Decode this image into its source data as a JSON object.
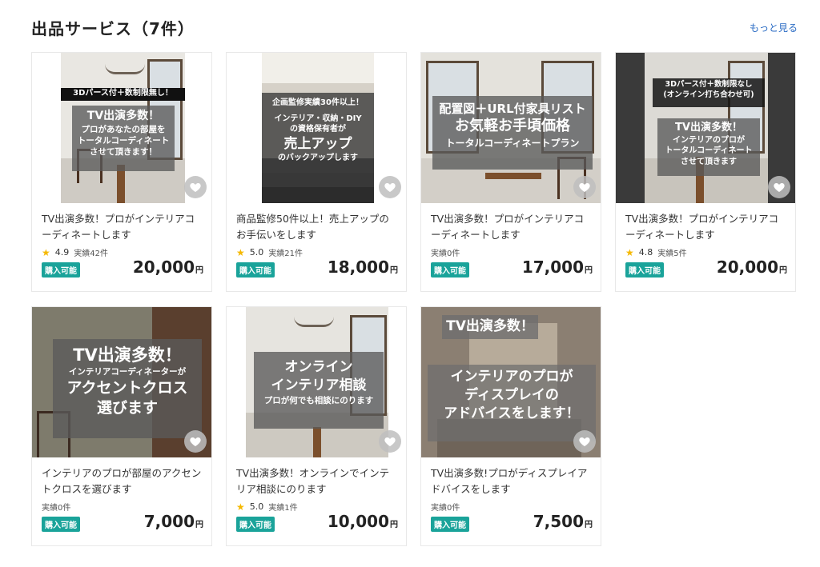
{
  "header": {
    "title": "出品サービス（7件）",
    "more_link": "もっと見る"
  },
  "cards": [
    {
      "overlay": [
        "3Dパース付＋数制限無し！",
        "TV出演多数！",
        "プロがあなたの部屋を",
        "トータルコーディネート",
        "させて頂きます！"
      ],
      "title": "TV出演多数！プロがインテリアコーディネートします",
      "rating": "4.9",
      "sales": "実績42件",
      "badge": "購入可能",
      "price": "20,000",
      "yen": "円"
    },
    {
      "overlay": [
        "企画監修実績30件以上！",
        "インテリア・収納・DIY",
        "の資格保有者が",
        "売上アップ",
        "のバックアップします"
      ],
      "title": "商品監修50件以上！売上アップのお手伝いをします",
      "rating": "5.0",
      "sales": "実績21件",
      "badge": "購入可能",
      "price": "18,000",
      "yen": "円"
    },
    {
      "overlay": [
        "配置図＋URL付家具リスト",
        "お気軽お手頃価格",
        "トータルコーディネートプラン"
      ],
      "title": "TV出演多数！プロがインテリアコーディネートします",
      "rating": "",
      "sales": "実績0件",
      "badge": "購入可能",
      "price": "17,000",
      "yen": "円"
    },
    {
      "overlay": [
        "3Dパース付＋数制限なし",
        "(オンライン打ち合わせ可)",
        "TV出演多数！",
        "インテリアのプロが",
        "トータルコーディネート",
        "させて頂きます"
      ],
      "title": "TV出演多数！プロがインテリアコーディネートします",
      "rating": "4.8",
      "sales": "実績5件",
      "badge": "購入可能",
      "price": "20,000",
      "yen": "円"
    },
    {
      "overlay": [
        "TV出演多数！",
        "インテリアコーディネーターが",
        "アクセントクロス",
        "選びます"
      ],
      "title": "インテリアのプロが部屋のアクセントクロスを選びます",
      "rating": "",
      "sales": "実績0件",
      "badge": "購入可能",
      "price": "7,000",
      "yen": "円"
    },
    {
      "overlay": [
        "オンライン",
        "インテリア相談",
        "プロが何でも相談にのります"
      ],
      "title": "TV出演多数！オンラインでインテリア相談にのります",
      "rating": "5.0",
      "sales": "実績1件",
      "badge": "購入可能",
      "price": "10,000",
      "yen": "円"
    },
    {
      "overlay": [
        "TV出演多数！",
        "インテリアのプロが",
        "ディスプレイの",
        "アドバイスをします！"
      ],
      "title": "TV出演多数!プロがディスプレイアドバイスをします",
      "rating": "",
      "sales": "実績0件",
      "badge": "購入可能",
      "price": "7,500",
      "yen": "円"
    }
  ],
  "colors": {
    "accent": "#1aa39a",
    "link": "#2b6cc4",
    "star": "#f5b800"
  }
}
